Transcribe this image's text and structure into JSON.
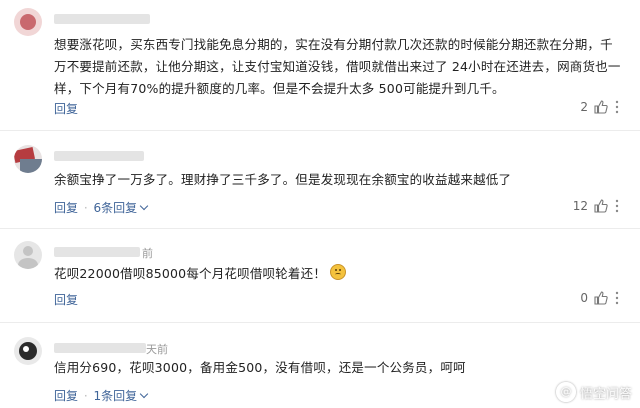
{
  "comments": [
    {
      "meta": "",
      "text": "想要涨花呗，买东西专门找能免息分期的，实在没有分期付款几次还款的时候能分期还款在分期，千万不要提前还款，让他分期这，让支付宝知道没钱，借呗就借出来过了 24小时在还进去，网商货也一样，下个月有70%的提升额度的几率。但是不会提升太多 500可能提升到几千。",
      "reply_label": "回复",
      "replies_label": "",
      "likes": "2"
    },
    {
      "meta": "",
      "text": "余额宝挣了一万多了。理财挣了三千多了。但是发现现在余额宝的收益越来越低了",
      "reply_label": "回复",
      "separator": "·",
      "replies_label": "6条回复",
      "likes": "12"
    },
    {
      "meta": "前",
      "text": "花呗22000借呗85000每个月花呗借呗轮着还！",
      "reply_label": "回复",
      "replies_label": "",
      "likes": "0"
    },
    {
      "meta": "天前",
      "text": "信用分690，花呗3000，备用金500，没有借呗，还是一个公务员，呵呵",
      "reply_label": "回复",
      "separator": "·",
      "replies_label": "1条回复",
      "likes": ""
    }
  ],
  "colors": {
    "link": "#406599",
    "text": "#222222",
    "muted": "#999999"
  },
  "icons": {
    "like": "thumbs-up-icon",
    "expand": "chevron-down-icon"
  },
  "watermark": {
    "text": "悟空问答",
    "symbol": "@"
  }
}
